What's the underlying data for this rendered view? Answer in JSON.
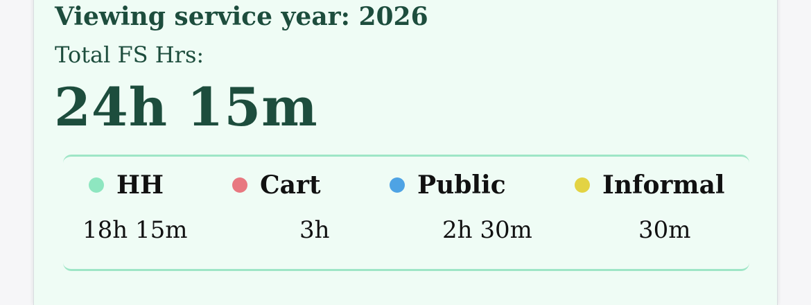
{
  "header": {
    "year_text": "Viewing service year: 2026",
    "total_label": "Total FS Hrs:",
    "total_value": "24h 15m"
  },
  "categories": [
    {
      "name": "HH",
      "value": "18h 15m",
      "color": "#8ee6c0"
    },
    {
      "name": "Cart",
      "value": "3h",
      "color": "#e87880"
    },
    {
      "name": "Public",
      "value": "2h 30m",
      "color": "#4ea3e4"
    },
    {
      "name": "Informal",
      "value": "30m",
      "color": "#e3d343"
    }
  ]
}
